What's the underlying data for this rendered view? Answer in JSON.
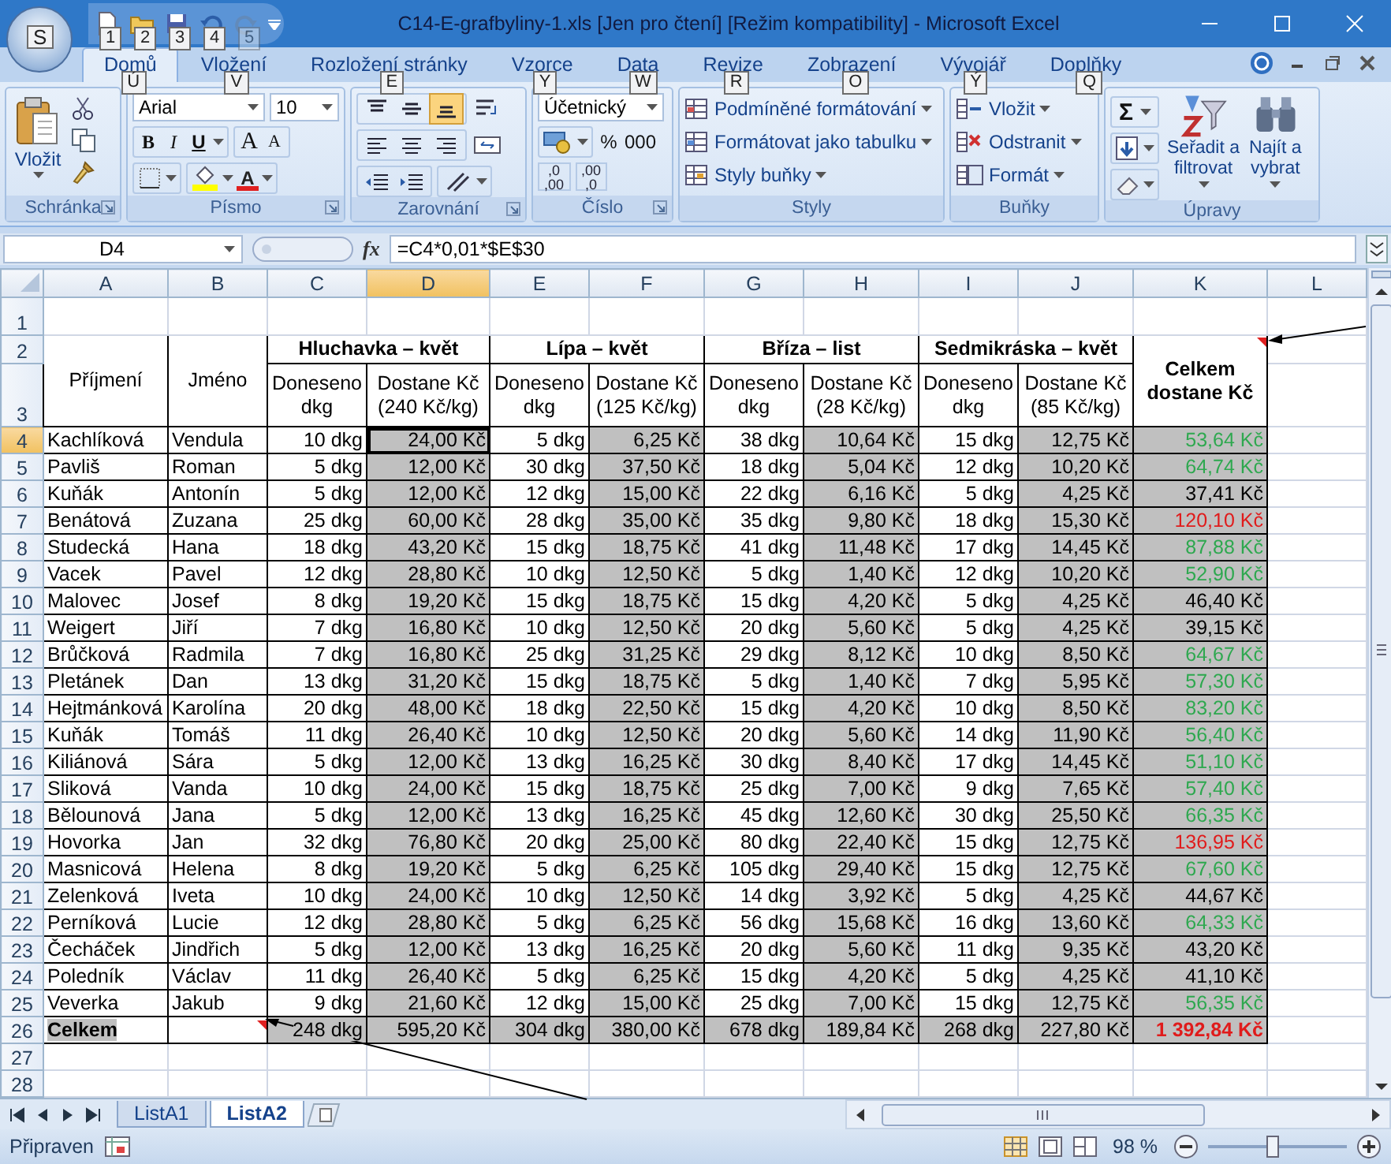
{
  "window": {
    "title": "C14-E-grafbyliny-1.xls [Jen pro čtení] [Režim kompatibility] - Microsoft Excel"
  },
  "office_button": {
    "key_tip": "S"
  },
  "quick_access": [
    {
      "key_tip": "1",
      "disabled": false
    },
    {
      "key_tip": "2",
      "disabled": false
    },
    {
      "key_tip": "3",
      "disabled": false
    },
    {
      "key_tip": "4",
      "disabled": false
    },
    {
      "key_tip": "5",
      "disabled": true
    }
  ],
  "ribbon": {
    "tabs": [
      {
        "label": "Domů",
        "key_tip": "Ú",
        "selected": true
      },
      {
        "label": "Vložení",
        "key_tip": "V",
        "selected": false
      },
      {
        "label": "Rozložení stránky",
        "key_tip": "E",
        "selected": false
      },
      {
        "label": "Vzorce",
        "key_tip": "Y",
        "selected": false
      },
      {
        "label": "Data",
        "key_tip": "W",
        "selected": false
      },
      {
        "label": "Revize",
        "key_tip": "R",
        "selected": false
      },
      {
        "label": "Zobrazení",
        "key_tip": "O",
        "selected": false
      },
      {
        "label": "Vývojář",
        "key_tip": "Ý",
        "selected": false
      },
      {
        "label": "Doplňky",
        "key_tip": "Q",
        "selected": false
      }
    ],
    "groups": [
      {
        "kind": "clipboard",
        "title": "Schránka",
        "paste_label": "Vložit"
      },
      {
        "kind": "font",
        "title": "Písmo",
        "font_name": "Arial",
        "font_size": "10",
        "style_buttons": [
          "B",
          "I",
          "U"
        ],
        "size_buttons": [
          "A",
          "A"
        ],
        "color_label": "A"
      },
      {
        "kind": "alignment",
        "title": "Zarovnání",
        "vertical_align": [
          {
            "selected": false
          },
          {
            "selected": false
          },
          {
            "selected": true
          }
        ]
      },
      {
        "kind": "number",
        "title": "Číslo",
        "format": "Účetnický",
        "percent": "%",
        "thousands": "000",
        "decimal_buttons": [
          {
            "top": ",0",
            "bottom": ",00"
          },
          {
            "top": ",00",
            "bottom": ",0"
          }
        ]
      },
      {
        "kind": "styles",
        "title": "Styly",
        "items": [
          "Podmíněné formátování",
          "Formátovat jako tabulku",
          "Styly buňky"
        ]
      },
      {
        "kind": "cells",
        "title": "Buňky",
        "items": [
          "Vložit",
          "Odstranit",
          "Formát"
        ]
      },
      {
        "kind": "editing",
        "title": "Úpravy",
        "sum": "Σ",
        "items": [
          "Seřadit a\nfiltrovat",
          "Najít a\nvybrat"
        ]
      }
    ]
  },
  "formula_bar": {
    "name_box": "D4",
    "fx": "fx",
    "formula": "=C4*0,01*$E$30"
  },
  "sheet": {
    "columns": [
      {
        "label": "A",
        "selected": false
      },
      {
        "label": "B",
        "selected": false
      },
      {
        "label": "C",
        "selected": false
      },
      {
        "label": "D",
        "selected": true
      },
      {
        "label": "E",
        "selected": false
      },
      {
        "label": "F",
        "selected": false
      },
      {
        "label": "G",
        "selected": false
      },
      {
        "label": "H",
        "selected": false
      },
      {
        "label": "I",
        "selected": false
      },
      {
        "label": "J",
        "selected": false
      },
      {
        "label": "K",
        "selected": false
      },
      {
        "label": "L",
        "selected": false
      }
    ],
    "header": {
      "surname": "Příjmení",
      "first_name": "Jméno",
      "total": "Celkem\ndostane Kč",
      "groups": [
        {
          "title": "Hluchavka – květ",
          "amount": "Doneseno\ndkg",
          "pay": "Dostane Kč\n(240 Kč/kg)"
        },
        {
          "title": "Lípa – květ",
          "amount": "Doneseno\ndkg",
          "pay": "Dostane Kč\n(125 Kč/kg)"
        },
        {
          "title": "Bříza – list",
          "amount": "Doneseno\ndkg",
          "pay": "Dostane Kč\n(28 Kč/kg)"
        },
        {
          "title": "Sedmikráska – květ",
          "amount": "Doneseno\ndkg",
          "pay": "Dostane Kč\n(85 Kč/kg)"
        }
      ]
    },
    "rows": [
      {
        "label": "1",
        "selected": false,
        "kind": "blank"
      },
      {
        "label": "2",
        "selected": false,
        "kind": "group_header"
      },
      {
        "label": "3",
        "selected": false,
        "kind": "sub_header"
      },
      {
        "label": "4",
        "selected": true,
        "kind": "data",
        "color": "#2ea84f",
        "cells": [
          "Kachlíková",
          "Vendula",
          "10 dkg",
          "24,00 Kč",
          "5 dkg",
          "6,25 Kč",
          "38 dkg",
          "10,64 Kč",
          "15 dkg",
          "12,75 Kč",
          "53,64 Kč"
        ]
      },
      {
        "label": "5",
        "selected": false,
        "kind": "data",
        "color": "#2ea84f",
        "cells": [
          "Pavliš",
          "Roman",
          "5 dkg",
          "12,00 Kč",
          "30 dkg",
          "37,50 Kč",
          "18 dkg",
          "5,04 Kč",
          "12 dkg",
          "10,20 Kč",
          "64,74 Kč"
        ]
      },
      {
        "label": "6",
        "selected": false,
        "kind": "data",
        "color": "#000000",
        "cells": [
          "Kuňák",
          "Antonín",
          "5 dkg",
          "12,00 Kč",
          "12 dkg",
          "15,00 Kč",
          "22 dkg",
          "6,16 Kč",
          "5 dkg",
          "4,25 Kč",
          "37,41 Kč"
        ]
      },
      {
        "label": "7",
        "selected": false,
        "kind": "data",
        "color": "#e01b1b",
        "cells": [
          "Benátová",
          "Zuzana",
          "25 dkg",
          "60,00 Kč",
          "28 dkg",
          "35,00 Kč",
          "35 dkg",
          "9,80 Kč",
          "18 dkg",
          "15,30 Kč",
          "120,10 Kč"
        ]
      },
      {
        "label": "8",
        "selected": false,
        "kind": "data",
        "color": "#2ea84f",
        "cells": [
          "Studecká",
          "Hana",
          "18 dkg",
          "43,20 Kč",
          "15 dkg",
          "18,75 Kč",
          "41 dkg",
          "11,48 Kč",
          "17 dkg",
          "14,45 Kč",
          "87,88 Kč"
        ]
      },
      {
        "label": "9",
        "selected": false,
        "kind": "data",
        "color": "#2ea84f",
        "cells": [
          "Vacek",
          "Pavel",
          "12 dkg",
          "28,80 Kč",
          "10 dkg",
          "12,50 Kč",
          "5 dkg",
          "1,40 Kč",
          "12 dkg",
          "10,20 Kč",
          "52,90 Kč"
        ]
      },
      {
        "label": "10",
        "selected": false,
        "kind": "data",
        "color": "#000000",
        "cells": [
          "Malovec",
          "Josef",
          "8 dkg",
          "19,20 Kč",
          "15 dkg",
          "18,75 Kč",
          "15 dkg",
          "4,20 Kč",
          "5 dkg",
          "4,25 Kč",
          "46,40 Kč"
        ]
      },
      {
        "label": "11",
        "selected": false,
        "kind": "data",
        "color": "#000000",
        "cells": [
          "Weigert",
          "Jiří",
          "7 dkg",
          "16,80 Kč",
          "10 dkg",
          "12,50 Kč",
          "20 dkg",
          "5,60 Kč",
          "5 dkg",
          "4,25 Kč",
          "39,15 Kč"
        ]
      },
      {
        "label": "12",
        "selected": false,
        "kind": "data",
        "color": "#2ea84f",
        "cells": [
          "Brůčková",
          "Radmila",
          "7 dkg",
          "16,80 Kč",
          "25 dkg",
          "31,25 Kč",
          "29 dkg",
          "8,12 Kč",
          "10 dkg",
          "8,50 Kč",
          "64,67 Kč"
        ]
      },
      {
        "label": "13",
        "selected": false,
        "kind": "data",
        "color": "#2ea84f",
        "cells": [
          "Pletánek",
          "Dan",
          "13 dkg",
          "31,20 Kč",
          "15 dkg",
          "18,75 Kč",
          "5 dkg",
          "1,40 Kč",
          "7 dkg",
          "5,95 Kč",
          "57,30 Kč"
        ]
      },
      {
        "label": "14",
        "selected": false,
        "kind": "data",
        "color": "#2ea84f",
        "cells": [
          "Hejtmánková",
          "Karolína",
          "20 dkg",
          "48,00 Kč",
          "18 dkg",
          "22,50 Kč",
          "15 dkg",
          "4,20 Kč",
          "10 dkg",
          "8,50 Kč",
          "83,20 Kč"
        ]
      },
      {
        "label": "15",
        "selected": false,
        "kind": "data",
        "color": "#2ea84f",
        "cells": [
          "Kuňák",
          "Tomáš",
          "11 dkg",
          "26,40 Kč",
          "10 dkg",
          "12,50 Kč",
          "20 dkg",
          "5,60 Kč",
          "14 dkg",
          "11,90 Kč",
          "56,40 Kč"
        ]
      },
      {
        "label": "16",
        "selected": false,
        "kind": "data",
        "color": "#2ea84f",
        "cells": [
          "Kiliánová",
          "Sára",
          "5 dkg",
          "12,00 Kč",
          "13 dkg",
          "16,25 Kč",
          "30 dkg",
          "8,40 Kč",
          "17 dkg",
          "14,45 Kč",
          "51,10 Kč"
        ]
      },
      {
        "label": "17",
        "selected": false,
        "kind": "data",
        "color": "#2ea84f",
        "cells": [
          "Sliková",
          "Vanda",
          "10 dkg",
          "24,00 Kč",
          "15 dkg",
          "18,75 Kč",
          "25 dkg",
          "7,00 Kč",
          "9 dkg",
          "7,65 Kč",
          "57,40 Kč"
        ]
      },
      {
        "label": "18",
        "selected": false,
        "kind": "data",
        "color": "#2ea84f",
        "cells": [
          "Bělounová",
          "Jana",
          "5 dkg",
          "12,00 Kč",
          "13 dkg",
          "16,25 Kč",
          "45 dkg",
          "12,60 Kč",
          "30 dkg",
          "25,50 Kč",
          "66,35 Kč"
        ]
      },
      {
        "label": "19",
        "selected": false,
        "kind": "data",
        "color": "#e01b1b",
        "cells": [
          "Hovorka",
          "Jan",
          "32 dkg",
          "76,80 Kč",
          "20 dkg",
          "25,00 Kč",
          "80 dkg",
          "22,40 Kč",
          "15 dkg",
          "12,75 Kč",
          "136,95 Kč"
        ]
      },
      {
        "label": "20",
        "selected": false,
        "kind": "data",
        "color": "#2ea84f",
        "cells": [
          "Masnicová",
          "Helena",
          "8 dkg",
          "19,20 Kč",
          "5 dkg",
          "6,25 Kč",
          "105 dkg",
          "29,40 Kč",
          "15 dkg",
          "12,75 Kč",
          "67,60 Kč"
        ]
      },
      {
        "label": "21",
        "selected": false,
        "kind": "data",
        "color": "#000000",
        "cells": [
          "Zelenková",
          "Iveta",
          "10 dkg",
          "24,00 Kč",
          "10 dkg",
          "12,50 Kč",
          "14 dkg",
          "3,92 Kč",
          "5 dkg",
          "4,25 Kč",
          "44,67 Kč"
        ]
      },
      {
        "label": "22",
        "selected": false,
        "kind": "data",
        "color": "#2ea84f",
        "cells": [
          "Perníková",
          "Lucie",
          "12 dkg",
          "28,80 Kč",
          "5 dkg",
          "6,25 Kč",
          "56 dkg",
          "15,68 Kč",
          "16 dkg",
          "13,60 Kč",
          "64,33 Kč"
        ]
      },
      {
        "label": "23",
        "selected": false,
        "kind": "data",
        "color": "#000000",
        "cells": [
          "Čecháček",
          "Jindřich",
          "5 dkg",
          "12,00 Kč",
          "13 dkg",
          "16,25 Kč",
          "20 dkg",
          "5,60 Kč",
          "11 dkg",
          "9,35 Kč",
          "43,20 Kč"
        ]
      },
      {
        "label": "24",
        "selected": false,
        "kind": "data",
        "color": "#000000",
        "cells": [
          "Poledník",
          "Václav",
          "11 dkg",
          "26,40 Kč",
          "5 dkg",
          "6,25 Kč",
          "15 dkg",
          "4,20 Kč",
          "5 dkg",
          "4,25 Kč",
          "41,10 Kč"
        ]
      },
      {
        "label": "25",
        "selected": false,
        "kind": "data",
        "color": "#2ea84f",
        "cells": [
          "Veverka",
          "Jakub",
          "9 dkg",
          "21,60 Kč",
          "12 dkg",
          "15,00 Kč",
          "25 dkg",
          "7,00 Kč",
          "15 dkg",
          "12,75 Kč",
          "56,35 Kč"
        ]
      },
      {
        "label": "26",
        "selected": false,
        "kind": "total",
        "color": "#e01b1b",
        "cells": [
          "Celkem",
          "248 dkg",
          "595,20 Kč",
          "304 dkg",
          "380,00 Kč",
          "678 dkg",
          "189,84 Kč",
          "268 dkg",
          "227,80 Kč",
          "1 392,84 Kč"
        ]
      },
      {
        "label": "27",
        "selected": false,
        "kind": "blank"
      },
      {
        "label": "28",
        "selected": false,
        "kind": "blank"
      }
    ]
  },
  "sheet_tabs": [
    {
      "label": "ListA1",
      "selected": false
    },
    {
      "label": "ListA2",
      "selected": true
    }
  ],
  "status_bar": {
    "text": "Připraven",
    "zoom": "98 %",
    "zoom_slider": {
      "level": 0.47
    }
  }
}
